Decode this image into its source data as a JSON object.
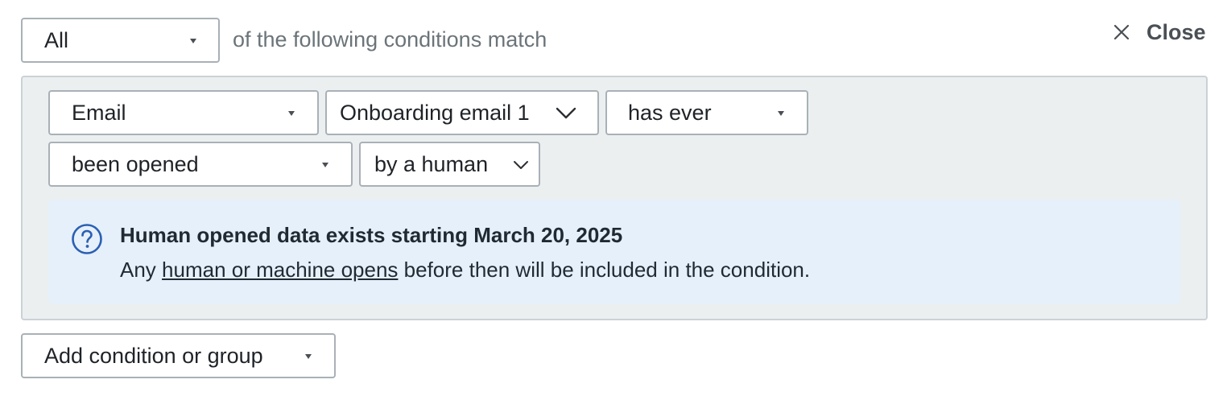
{
  "match_selector": {
    "value": "All"
  },
  "match_text": "of the following conditions match",
  "close": {
    "label": "Close"
  },
  "condition": {
    "type_select": {
      "value": "Email"
    },
    "email_select": {
      "value": "Onboarding email 1"
    },
    "frequency_select": {
      "value": "has ever"
    },
    "action_select": {
      "value": "been opened"
    },
    "actor_select": {
      "value": "by a human"
    }
  },
  "info": {
    "icon": "question-circle-icon",
    "title": "Human opened data exists starting March 20, 2025",
    "body_prefix": "Any ",
    "body_link": "human or machine opens",
    "body_suffix": " before then will be included in the condition."
  },
  "add_condition": {
    "label": "Add condition or group"
  },
  "colors": {
    "info_background": "#e6f0fa",
    "info_icon": "#2b5fb3",
    "group_background": "#eceff0"
  }
}
